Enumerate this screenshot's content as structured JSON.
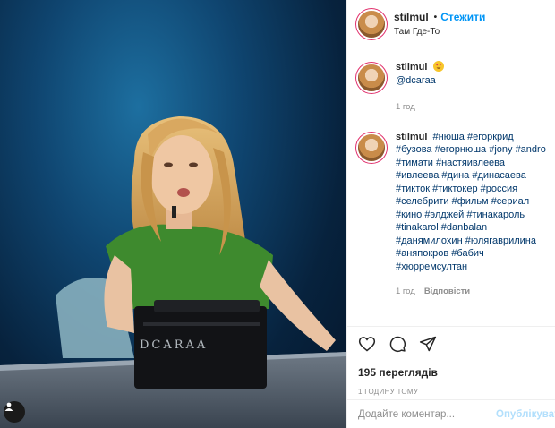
{
  "header": {
    "username": "stilmul",
    "dot": "•",
    "follow_label": "Стежити",
    "location": "Там Где-То"
  },
  "video": {
    "watermark": "DCARAA"
  },
  "comments": [
    {
      "username": "stilmul",
      "emoji_icon": "heart-eyes-emoji-icon",
      "mention": "@dcaraa",
      "time": "1 год"
    },
    {
      "username": "stilmul",
      "tags": [
        "#нюша",
        "#егоркрид",
        "#бузова",
        "#егорнюша",
        "#jony",
        "#andro",
        "#тимати",
        "#настяивлеева",
        "#ивлеева",
        "#дина",
        "#динасаева",
        "#тикток",
        "#тиктокер",
        "#россия",
        "#селебрити",
        "#фильм",
        "#сериал",
        "#кино",
        "#элджей",
        "#тинакароль",
        "#tinakarol",
        "#danbalan",
        "#данямилохин",
        "#юлягаврилина",
        "#аняпокров",
        "#бабич",
        "#хюрремсултан"
      ],
      "time": "1 год",
      "reply_label": "Відповісти"
    }
  ],
  "actions": {
    "icons": [
      "heart-icon",
      "comment-icon",
      "share-icon"
    ],
    "views": "195 переглядів",
    "timestamp": "1 ГОДИНУ ТОМУ"
  },
  "add_comment": {
    "placeholder": "Додайте коментар...",
    "post_label": "Опублікувати"
  },
  "colors": {
    "accent": "#0095f6",
    "tag": "#00376b",
    "muted": "#8e8e8e",
    "post_disabled": "#b2dffc"
  }
}
